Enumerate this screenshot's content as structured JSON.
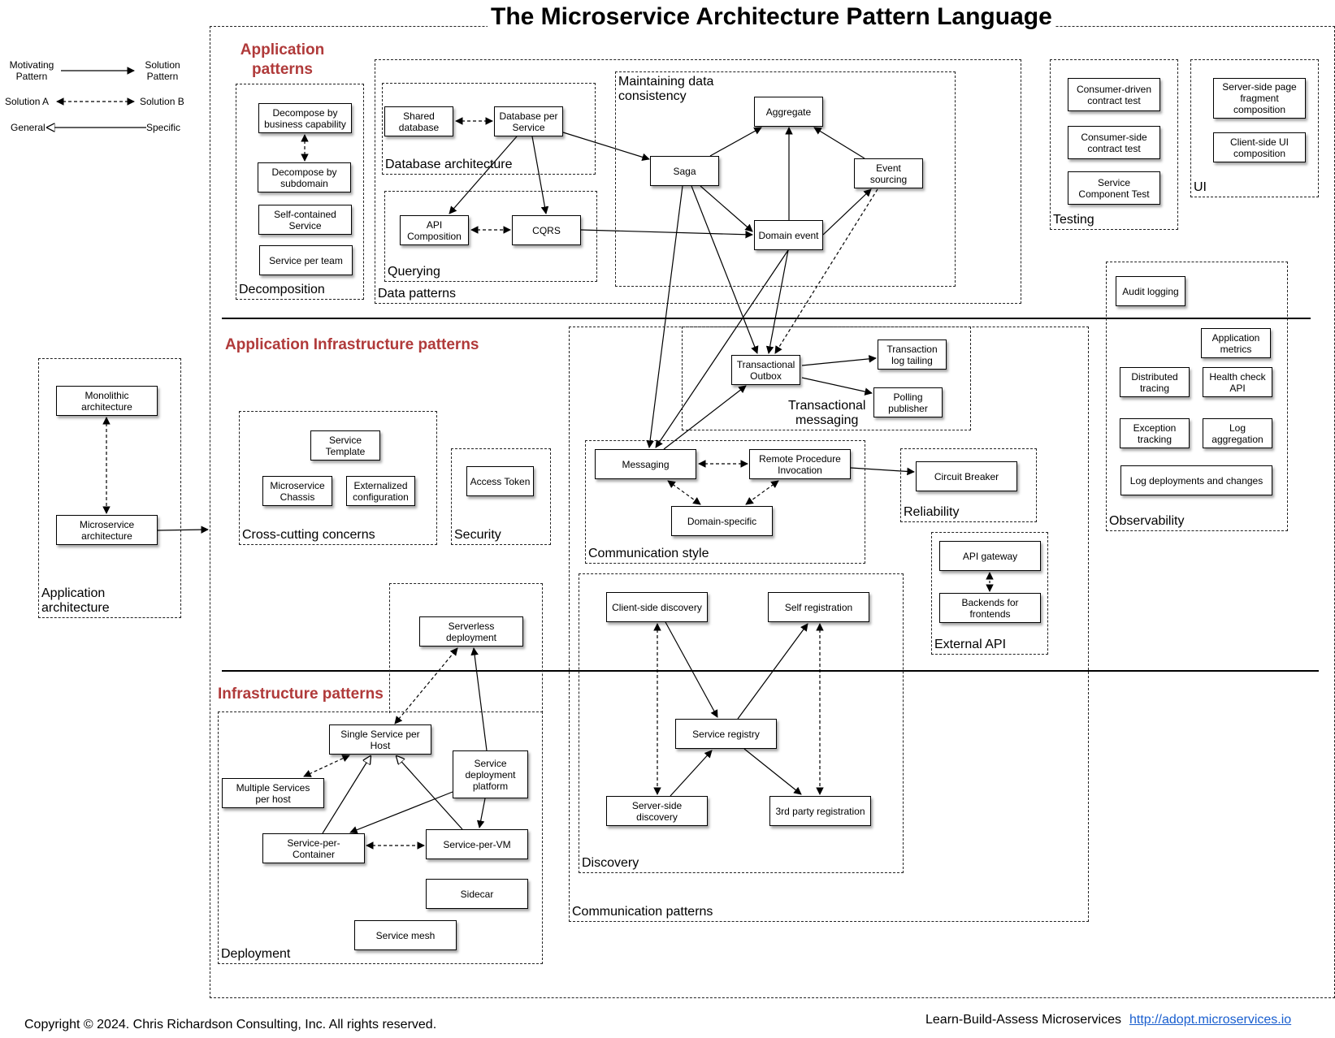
{
  "title": "The Microservice Architecture Pattern Language",
  "legend": {
    "motivating": "Motivating\nPattern",
    "solution": "Solution\nPattern",
    "solution_a": "Solution A",
    "solution_b": "Solution B",
    "general": "General",
    "specific": "Specific"
  },
  "sections": {
    "application": "Application\npatterns",
    "app_infra": "Application Infrastructure patterns",
    "infra": "Infrastructure patterns"
  },
  "groups": {
    "decomposition": "Decomposition",
    "data_patterns": "Data patterns",
    "database_architecture": "Database architecture",
    "querying": "Querying",
    "maintaining_consistency": "Maintaining data\nconsistency",
    "testing": "Testing",
    "ui": "UI",
    "observability": "Observability",
    "application_architecture": "Application\narchitecture",
    "cross_cutting": "Cross-cutting concerns",
    "security": "Security",
    "transactional_messaging": "Transactional\nmessaging",
    "communication_style": "Communication style",
    "reliability": "Reliability",
    "external_api": "External API",
    "discovery": "Discovery",
    "communication_patterns": "Communication patterns",
    "deployment": "Deployment"
  },
  "nodes": {
    "decompose_business": "Decompose by\nbusiness capability",
    "decompose_subdomain": "Decompose by\nsubdomain",
    "self_contained": "Self-contained\nService",
    "service_per_team": "Service per team",
    "shared_database": "Shared\ndatabase",
    "database_per_service": "Database per\nService",
    "api_composition": "API\nComposition",
    "cqrs": "CQRS",
    "aggregate": "Aggregate",
    "saga": "Saga",
    "event_sourcing": "Event\nsourcing",
    "domain_event": "Domain event",
    "consumer_driven": "Consumer-driven\ncontract test",
    "consumer_side": "Consumer-side\ncontract test",
    "service_component_test": "Service\nComponent Test",
    "server_side_fragment": "Server-side page\nfragment\ncomposition",
    "client_side_ui": "Client-side  UI\ncomposition",
    "audit_logging": "Audit logging",
    "application_metrics": "Application\nmetrics",
    "distributed_tracing": "Distributed\ntracing",
    "health_check": "Health check\nAPI",
    "exception_tracking": "Exception\ntracking",
    "log_aggregation": "Log\naggregation",
    "log_deployments": "Log deployments and changes",
    "monolithic": "Monolithic\narchitecture",
    "microservice": "Microservice\narchitecture",
    "service_template": "Service\nTemplate",
    "microservice_chassis": "Microservice\nChassis",
    "externalized_config": "Externalized\nconfiguration",
    "access_token": "Access Token",
    "transactional_outbox": "Transactional\nOutbox",
    "transaction_log_tailing": "Transaction\nlog tailing",
    "polling_publisher": "Polling\npublisher",
    "messaging": "Messaging",
    "rpi": "Remote Procedure\nInvocation",
    "domain_specific": "Domain-specific",
    "circuit_breaker": "Circuit Breaker",
    "api_gateway": "API gateway",
    "bff": "Backends for\nfrontends",
    "client_side_discovery": "Client-side discovery",
    "self_registration": "Self registration",
    "service_registry": "Service registry",
    "server_side_discovery": "Server-side\ndiscovery",
    "third_party_registration": "3rd party registration",
    "serverless": "Serverless\ndeployment",
    "single_service_host": "Single Service per\nHost",
    "multiple_services_host": "Multiple Services\nper host",
    "service_deployment_platform": "Service\ndeployment\nplatform",
    "service_per_container": "Service-per-\nContainer",
    "service_per_vm": "Service-per-VM",
    "sidecar": "Sidecar",
    "service_mesh": "Service mesh"
  },
  "footer": {
    "copyright": "Copyright © 2024. Chris Richardson Consulting, Inc. All rights reserved.",
    "tagline": "Learn-Build-Assess Microservices",
    "link": "http://adopt.microservices.io"
  }
}
